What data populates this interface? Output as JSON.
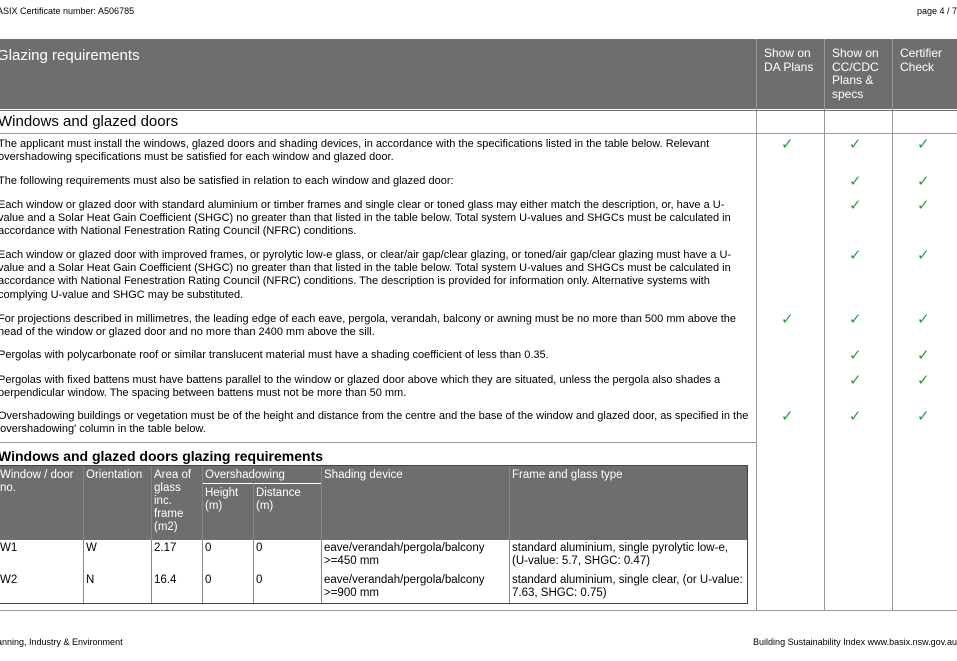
{
  "top": {
    "certificate": "ASIX Certificate number: A506785",
    "page": "page 4 / 7"
  },
  "header": {
    "title": "Glazing requirements",
    "col1": "Show on DA Plans",
    "col2": "Show on CC/CDC Plans & specs",
    "col3": "Certifier Check"
  },
  "section": {
    "title": "Windows and glazed doors"
  },
  "requirements": [
    {
      "text": "The applicant must install the windows, glazed doors and shading devices, in accordance with the specifications listed in the table below. Relevant overshadowing specifications must be satisfied for each window and glazed door.",
      "ticks": [
        true,
        true,
        true
      ]
    },
    {
      "text": "The following requirements must also be satisfied in relation to each window and glazed door:",
      "ticks": [
        false,
        true,
        true
      ]
    },
    {
      "text": "Each window or glazed door with standard aluminium or timber frames and single clear or toned glass may either match the description, or, have a U-value and a Solar Heat Gain Coefficient (SHGC) no greater than that listed in the table below. Total system U-values and SHGCs must be calculated in accordance with National Fenestration Rating Council (NFRC) conditions.",
      "ticks": [
        false,
        true,
        true
      ]
    },
    {
      "text": "Each window or glazed door with improved frames, or pyrolytic low-e glass, or clear/air gap/clear glazing, or toned/air gap/clear glazing must have a U-value and a Solar Heat Gain Coefficient (SHGC) no greater than that listed in the table below. Total system U-values and SHGCs must be calculated in accordance with National Fenestration Rating Council (NFRC) conditions. The description is provided for information only. Alternative systems with complying U-value and SHGC may be substituted.",
      "ticks": [
        false,
        true,
        true
      ]
    },
    {
      "text": "For projections described in millimetres, the leading edge of each eave, pergola, verandah, balcony or awning must be no more than 500 mm above the head of the window or glazed door and no more than 2400 mm above the sill.",
      "ticks": [
        true,
        true,
        true
      ]
    },
    {
      "text": "Pergolas with polycarbonate roof or similar translucent material must have a shading coefficient of less than 0.35.",
      "ticks": [
        false,
        true,
        true
      ]
    },
    {
      "text": "Pergolas with fixed battens must have battens parallel to the window or glazed door above which they are situated, unless the pergola also shades a perpendicular window. The spacing between battens must not be more than 50 mm.",
      "ticks": [
        false,
        true,
        true
      ]
    },
    {
      "text": "Overshadowing buildings or vegetation must be of the height and distance from the centre and the base of the window and glazed door, as specified in the 'overshadowing' column in the table below.",
      "ticks": [
        true,
        true,
        true
      ]
    }
  ],
  "tick_symbol": "✓",
  "tick_color": "#2e9a3e",
  "glazing_table": {
    "title": "Windows and glazed doors glazing requirements",
    "headers": {
      "window": "Window / door no.",
      "orientation": "Orientation",
      "area": "Area of glass inc. frame (m2)",
      "overshadowing": "Overshadowing",
      "height": "Height (m)",
      "distance": "Distance (m)",
      "shading": "Shading device",
      "frame": "Frame and glass type"
    },
    "rows": [
      {
        "window": "W1",
        "orientation": "W",
        "area": "2.17",
        "height": "0",
        "distance": "0",
        "shading": "eave/verandah/pergola/balcony >=450 mm",
        "frame": "standard aluminium, single pyrolytic low-e, (U-value: 5.7, SHGC: 0.47)"
      },
      {
        "window": "W2",
        "orientation": "N",
        "area": "16.4",
        "height": "0",
        "distance": "0",
        "shading": "eave/verandah/pergola/balcony >=900 mm",
        "frame": "standard aluminium, single clear, (or U-value: 7.63, SHGC: 0.75)"
      }
    ]
  },
  "footer": {
    "left": "anning, Industry & Environment",
    "right": "Building Sustainability Index www.basix.nsw.gov.au"
  }
}
